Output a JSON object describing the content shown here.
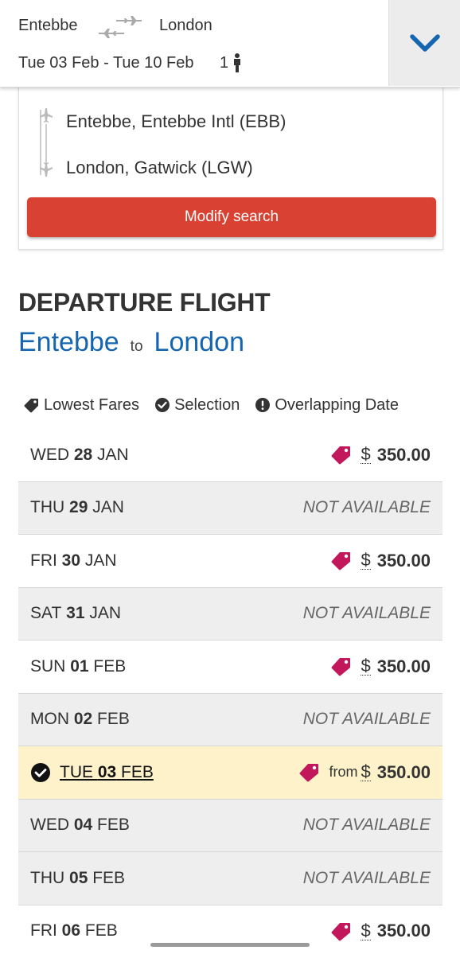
{
  "summary": {
    "origin": "Entebbe",
    "destination": "London",
    "dates": "Tue 03 Feb - Tue 10 Feb",
    "passengers": "1"
  },
  "search_panel": {
    "origin_airport": "Entebbe, Entebbe Intl (EBB)",
    "destination_airport": "London, Gatwick (LGW)",
    "modify_label": "Modify search"
  },
  "departure": {
    "heading": "DEPARTURE FLIGHT",
    "from": "Entebbe",
    "to_word": "to",
    "to": "London"
  },
  "legend": {
    "lowest_fares": "Lowest Fares",
    "selection": "Selection",
    "overlapping": "Overlapping Date"
  },
  "dates": [
    {
      "dow": "WED",
      "day": "28",
      "mon": "JAN",
      "status": "fare",
      "from": "",
      "currency": "$",
      "price": "350.00"
    },
    {
      "dow": "THU",
      "day": "29",
      "mon": "JAN",
      "status": "na",
      "na": "NOT AVAILABLE"
    },
    {
      "dow": "FRI",
      "day": "30",
      "mon": "JAN",
      "status": "fare",
      "from": "",
      "currency": "$",
      "price": "350.00"
    },
    {
      "dow": "SAT",
      "day": "31",
      "mon": "JAN",
      "status": "na",
      "na": "NOT AVAILABLE"
    },
    {
      "dow": "SUN",
      "day": "01",
      "mon": "FEB",
      "status": "fare",
      "from": "",
      "currency": "$",
      "price": "350.00"
    },
    {
      "dow": "MON",
      "day": "02",
      "mon": "FEB",
      "status": "na",
      "na": "NOT AVAILABLE"
    },
    {
      "dow": "TUE",
      "day": "03",
      "mon": "FEB",
      "status": "fare",
      "selected": true,
      "from": "from",
      "currency": "$",
      "price": "350.00"
    },
    {
      "dow": "WED",
      "day": "04",
      "mon": "FEB",
      "status": "na",
      "na": "NOT AVAILABLE"
    },
    {
      "dow": "THU",
      "day": "05",
      "mon": "FEB",
      "status": "na",
      "na": "NOT AVAILABLE"
    },
    {
      "dow": "FRI",
      "day": "06",
      "mon": "FEB",
      "status": "fare",
      "from": "",
      "currency": "$",
      "price": "350.00"
    }
  ],
  "colors": {
    "accent_blue": "#1565b0",
    "button_red": "#d94232",
    "tag_magenta": "#c2185b",
    "selected_row": "#fdf2c9"
  },
  "icons": [
    "planes-icon",
    "person-icon",
    "chevron-down-icon",
    "plane-takeoff-icon",
    "plane-landing-icon",
    "tag-icon",
    "check-circle-icon",
    "exclamation-circle-icon"
  ]
}
